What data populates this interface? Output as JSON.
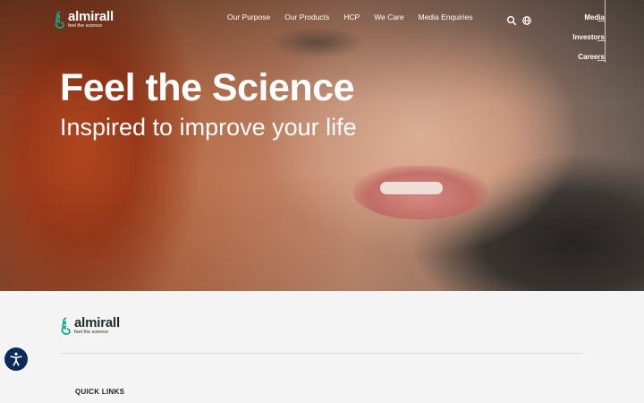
{
  "brand": {
    "name": "almirall",
    "tagline": "feel the science",
    "accent_color": "#12a884"
  },
  "header": {
    "nav": [
      "Our Purpose",
      "Our Products",
      "HCP",
      "We Care",
      "Media Enquiries"
    ],
    "search_icon": "search-icon",
    "language_icon": "globe-icon",
    "side_links": [
      "Media",
      "Investors",
      "Careers"
    ]
  },
  "hero": {
    "title": "Feel the Science",
    "subtitle": "Inspired to improve your life"
  },
  "footer": {
    "quick_links_heading": "QUICK LINKS"
  },
  "accessibility": {
    "icon": "accessibility-icon",
    "color": "#0b2a5b"
  }
}
